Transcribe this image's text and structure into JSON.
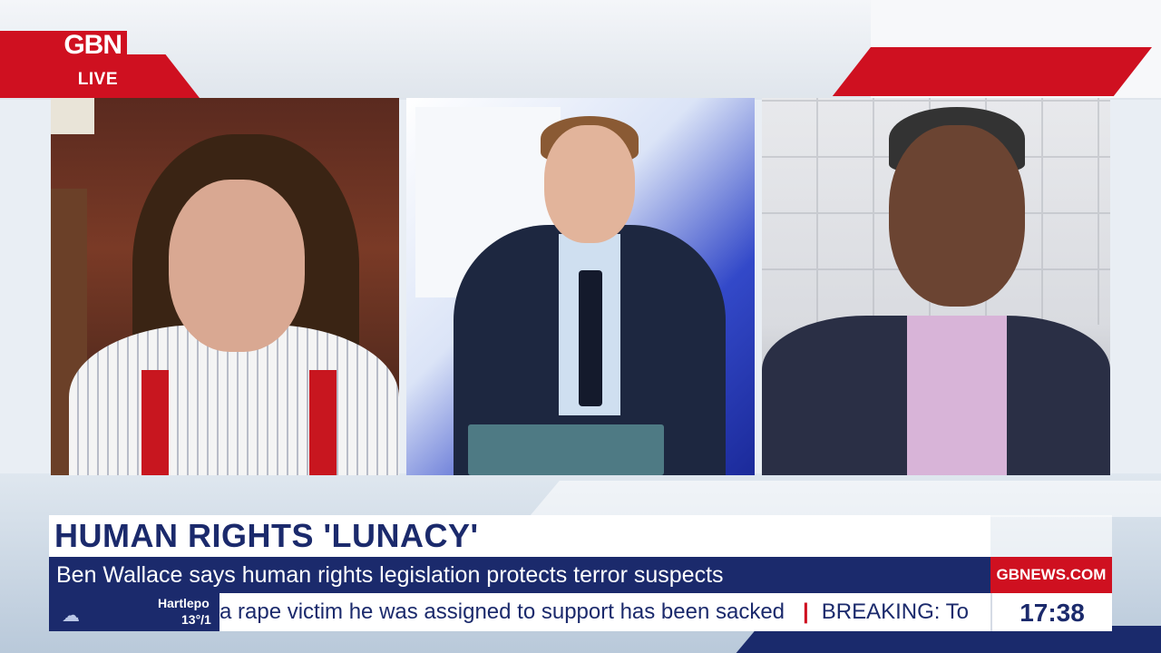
{
  "brand": {
    "logo_text": "GBN",
    "live_label": "LIVE",
    "site": "GBNEWS.COM",
    "colors": {
      "red": "#cf1020",
      "navy": "#1b2a6c"
    }
  },
  "lower_third": {
    "headline": "HUMAN RIGHTS 'LUNACY'",
    "subheadline": "Ben Wallace says human rights legislation protects terror suspects"
  },
  "ticker": {
    "weather_icon": "cloud-icon",
    "weather_place": "Hartlepo",
    "weather_temp": "13°/1",
    "story": "a rape victim he was assigned to support has been sacked",
    "separator": "|",
    "next_story": "BREAKING: To"
  },
  "clock": {
    "time": "17:38"
  }
}
